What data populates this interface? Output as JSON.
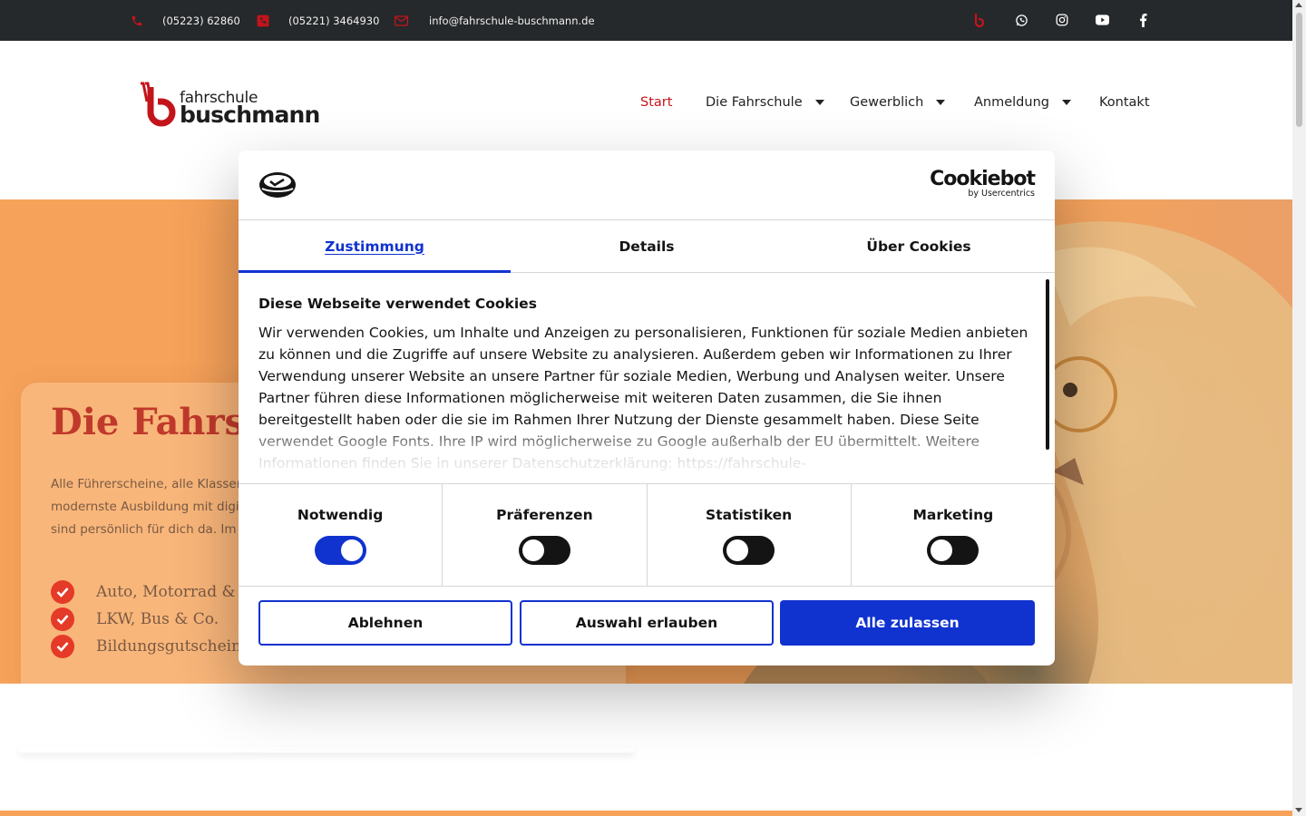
{
  "topbar": {
    "phone1": "(05223) 62860",
    "phone2": "(05221) 3464930",
    "email": "info@fahrschule-buschmann.de",
    "socials": [
      "brand-b-icon",
      "whatsapp-icon",
      "instagram-icon",
      "youtube-icon",
      "facebook-icon"
    ],
    "accent": "#c4141b"
  },
  "header": {
    "logo_line1": "fahrschule",
    "logo_line2": "buschmann",
    "nav": [
      {
        "label": "Start",
        "active": true
      },
      {
        "label": "Die Fahrschule",
        "dropdown": true
      },
      {
        "label": "Gewerblich",
        "dropdown": true
      },
      {
        "label": "Anmeldung",
        "dropdown": true
      },
      {
        "label": "Kontakt"
      }
    ]
  },
  "hero": {
    "title": "Die Fahrschul",
    "text_line1": "Alle Führerscheine, alle Klassen u",
    "text_line2": "modernste Ausbildung mit digital",
    "text_line3": "sind persönlich für dich da. Im Fal",
    "list": [
      "Auto, Motorrad & C",
      "LKW, Bus & Co.",
      "Bildungsgutschein"
    ],
    "bg_color": "#f7a25a"
  },
  "cookie_dialog": {
    "brand": "Cookiebot",
    "brand_sub": "by Usercentrics",
    "tabs": [
      {
        "label": "Zustimmung",
        "active": true
      },
      {
        "label": "Details"
      },
      {
        "label": "Über Cookies"
      }
    ],
    "title": "Diese Webseite verwendet Cookies",
    "body": "Wir verwenden Cookies, um Inhalte und Anzeigen zu personalisieren, Funktionen für soziale Medien anbieten zu können und die Zugriffe auf unsere Website zu analysieren. Außerdem geben wir Informationen zu Ihrer Verwendung unserer Website an unsere Partner für soziale Medien, Werbung und Analysen weiter. Unsere Partner führen diese Informationen möglicherweise mit weiteren Daten zusammen, die Sie ihnen bereitgestellt haben oder die sie im Rahmen Ihrer Nutzung der Dienste gesammelt haben. Diese Seite verwendet Google Fonts. Ihre IP wird möglicherweise zu Google außerhalb der EU übermittelt. Weitere Informationen finden Sie in unserer Datenschutzerklärung: https://fahrschule-",
    "categories": [
      {
        "label": "Notwendig",
        "enabled": true
      },
      {
        "label": "Präferenzen",
        "enabled": false
      },
      {
        "label": "Statistiken",
        "enabled": false
      },
      {
        "label": "Marketing",
        "enabled": false
      }
    ],
    "buttons": {
      "deny": "Ablehnen",
      "allow_selection": "Auswahl erlauben",
      "allow_all": "Alle zulassen"
    },
    "accent": "#1032cf"
  }
}
